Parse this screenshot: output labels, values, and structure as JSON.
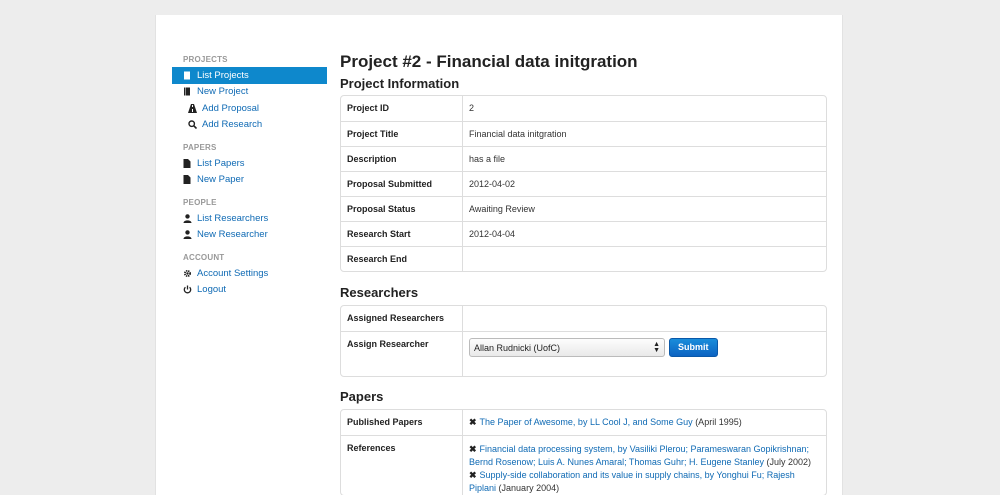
{
  "sidebar": {
    "groups": [
      {
        "header": "PROJECTS",
        "items": [
          {
            "label": "List Projects",
            "icon": "book-icon"
          },
          {
            "label": "New Project",
            "icon": "book-icon"
          },
          {
            "label": "Add Proposal",
            "icon": "road-icon"
          },
          {
            "label": "Add Research",
            "icon": "search-icon"
          }
        ]
      },
      {
        "header": "PAPERS",
        "items": [
          {
            "label": "List Papers",
            "icon": "file-icon"
          },
          {
            "label": "New Paper",
            "icon": "file-icon"
          }
        ]
      },
      {
        "header": "PEOPLE",
        "items": [
          {
            "label": "List Researchers",
            "icon": "user-icon"
          },
          {
            "label": "New Researcher",
            "icon": "user-icon"
          }
        ]
      },
      {
        "header": "ACCOUNT",
        "items": [
          {
            "label": "Account Settings",
            "icon": "cog-icon"
          },
          {
            "label": "Logout",
            "icon": "power-icon"
          }
        ]
      }
    ]
  },
  "page": {
    "title": "Project #2 - Financial data initgration",
    "info_heading": "Project Information",
    "info_rows": [
      {
        "label": "Project ID",
        "value": "2"
      },
      {
        "label": "Project Title",
        "value": "Financial data initgration"
      },
      {
        "label": "Description",
        "value": "has a file"
      },
      {
        "label": "Proposal Submitted",
        "value": "2012-04-02"
      },
      {
        "label": "Proposal Status",
        "value": "Awaiting Review"
      },
      {
        "label": "Research Start",
        "value": "2012-04-04"
      },
      {
        "label": "Research End",
        "value": ""
      }
    ],
    "researchers_heading": "Researchers",
    "assigned_label": "Assigned Researchers",
    "assigned_value": "",
    "assign_label": "Assign Researcher",
    "assign_selected": "Allan Rudnicki (UofC)",
    "submit_label": "Submit",
    "papers_heading": "Papers",
    "published_label": "Published Papers",
    "published": [
      {
        "link": "The Paper of Awesome, by LL Cool J, and Some Guy",
        "suffix": "(April 1995)"
      }
    ],
    "references_label": "References",
    "references": [
      {
        "link": "Financial data processing system, by Vasiliki Plerou; Parameswaran Gopikrishnan; Bernd Rosenow; Luis A. Nunes Amaral; Thomas Guhr; H. Eugene Stanley",
        "suffix": "(July 2002)"
      },
      {
        "link": "Supply-side collaboration and its value in supply chains, by Yonghui Fu; Rajesh Piplani",
        "suffix": "(January 2004)"
      }
    ]
  },
  "colors": {
    "active_nav": "#0e88cc",
    "link": "#0f6ab4",
    "button": "#0c63c2"
  }
}
